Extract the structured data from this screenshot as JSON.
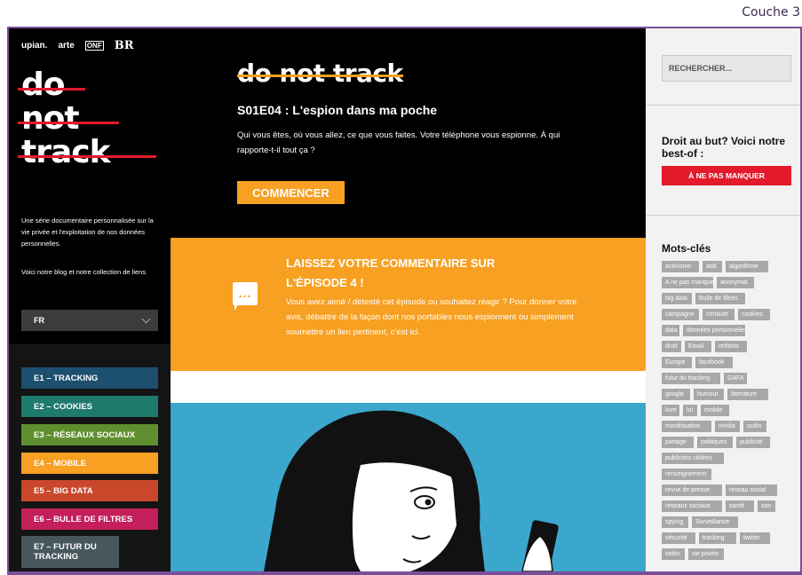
{
  "window_label": "Couche 3",
  "sidebar": {
    "partners": [
      "upian.",
      "arte",
      "ONF",
      "BR"
    ],
    "logo_lines": [
      "do",
      "not",
      "track"
    ],
    "description": "Une série documentaire personnalisée sur la vie privée et l'exploitation de nos données personnelles.",
    "blog_text": "Voici notre blog et notre collection de liens",
    "language": "FR",
    "episodes": [
      {
        "label": "E1 – TRACKING",
        "color": "#1d4f6e"
      },
      {
        "label": "E2 – COOKIES",
        "color": "#1e7a6d"
      },
      {
        "label": "E3 – RÉSEAUX SOCIAUX",
        "color": "#5f8f2f"
      },
      {
        "label": "E4 – MOBILE",
        "color": "#f7a021"
      },
      {
        "label": "E5 – BIG DATA",
        "color": "#c9472a"
      },
      {
        "label": "E6 – BULLE DE FILTRES",
        "color": "#c41f5a"
      },
      {
        "label": "E7 – FUTUR DU TRACKING",
        "color": "#47575e"
      }
    ]
  },
  "main": {
    "brand_title": "do not track",
    "episode_title": "S01E04 : L'espion dans ma poche",
    "episode_description": "Qui vous êtes, où vous allez, ce que vous faites. Votre téléphone vous espionne. À qui rapporte-t-il tout ça ?",
    "start_button": "COMMENCER",
    "comment_title": "LAISSEZ VOTRE COMMENTAIRE SUR L'ÉPISODE 4 !",
    "comment_text": "Vous avez aimé / détesté cet épisode ou souhaitez réagir ? Pour donner votre avis, débattre de la façon dont nos portables nous espionnent ou simplement soumettre un lien pertinent, c'est ici.",
    "comment_icon_dots": "..."
  },
  "right": {
    "search_placeholder": "RECHERCHER...",
    "bestof_title": "Droit au but? Voici notre best-of :",
    "bestof_button": "À NE PAS MANQUER",
    "keywords_title": "Mots-clés",
    "tags": [
      "activisme",
      "add",
      "algorithme",
      "A ne pas manquer",
      "anonymat",
      "big data",
      "Bulle de filtres",
      "campagne",
      "censure",
      "cookies",
      "data",
      "données personnelles",
      "droit",
      "Email",
      "enfants",
      "Europe",
      "facebook",
      "futur du tracking",
      "GAFA",
      "google",
      "humour",
      "litterature",
      "livre",
      "loi",
      "mobile",
      "monétisation",
      "média",
      "outils",
      "partage",
      "politiques",
      "publicité",
      "publicités ciblées",
      "renseignement",
      "revue de presse",
      "réseau social",
      "réseaux sociaux",
      "santé",
      "son",
      "spying",
      "Surveillance",
      "sécurité",
      "tracking",
      "twitter",
      "vidéo",
      "vie privée"
    ]
  },
  "colors": {
    "frame": "#7a4f98",
    "accent_orange": "#f7a021",
    "accent_red": "#e21a2b",
    "illustration_blue": "#3ba7cc"
  }
}
